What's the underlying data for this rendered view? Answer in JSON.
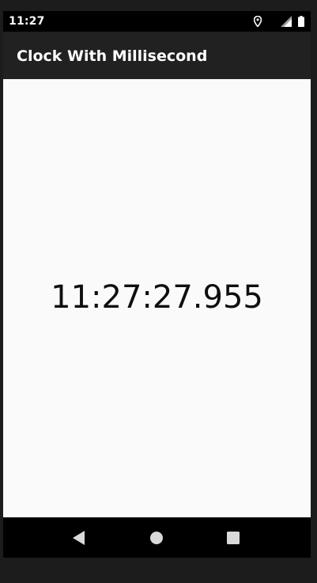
{
  "status_bar": {
    "time": "11:27",
    "icons": [
      "location-icon",
      "cell-signal-icon",
      "battery-icon"
    ]
  },
  "app_bar": {
    "title": "Clock With Millisecond"
  },
  "main": {
    "clock_display": "11:27:27.955"
  },
  "nav_bar": {
    "buttons": [
      "back-icon",
      "home-icon",
      "recents-icon"
    ]
  },
  "colors": {
    "status_bar": "#000000",
    "app_bar": "#212121",
    "background": "#fafafa",
    "text": "#0f0f0f",
    "nav_bar": "#000000"
  }
}
